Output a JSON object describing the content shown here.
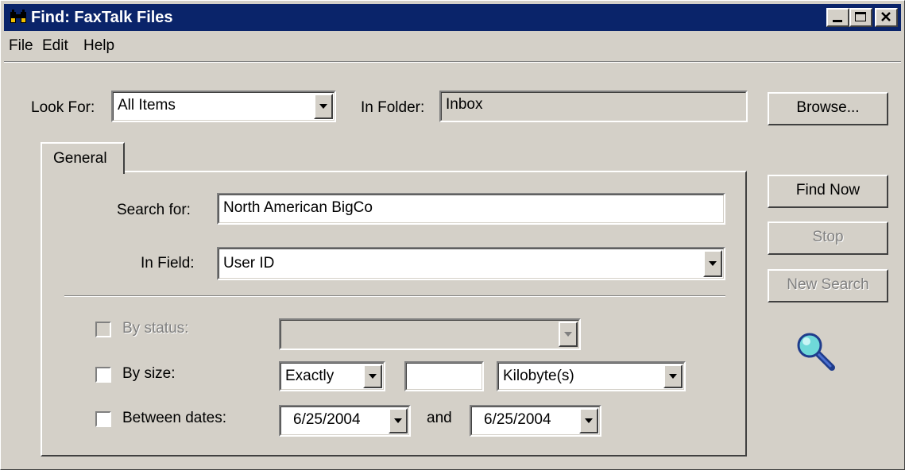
{
  "window": {
    "title": "Find: FaxTalk Files",
    "icon": "binoculars-icon"
  },
  "menu": {
    "file": "File",
    "edit": "Edit",
    "help": "Help"
  },
  "lookfor": {
    "label": "Look For:",
    "value": "All Items"
  },
  "infolder": {
    "label": "In Folder:",
    "value": "Inbox"
  },
  "buttons": {
    "browse": "Browse...",
    "find_now": "Find Now",
    "stop": "Stop",
    "new_search": "New Search"
  },
  "tabs": {
    "general": "General"
  },
  "search": {
    "search_for_label": "Search for:",
    "search_for_value": "North American BigCo",
    "in_field_label": "In Field:",
    "in_field_value": "User ID"
  },
  "filters": {
    "by_status_label": "By status:",
    "by_status_value": "",
    "by_size_label": "By size:",
    "size_compare": "Exactly",
    "size_amount": "",
    "size_unit": "Kilobyte(s)",
    "between_dates_label": "Between dates:",
    "date_from": "6/25/2004",
    "and_label": "and",
    "date_to": "6/25/2004"
  },
  "icons": {
    "magnifier": "magnifier-icon"
  }
}
